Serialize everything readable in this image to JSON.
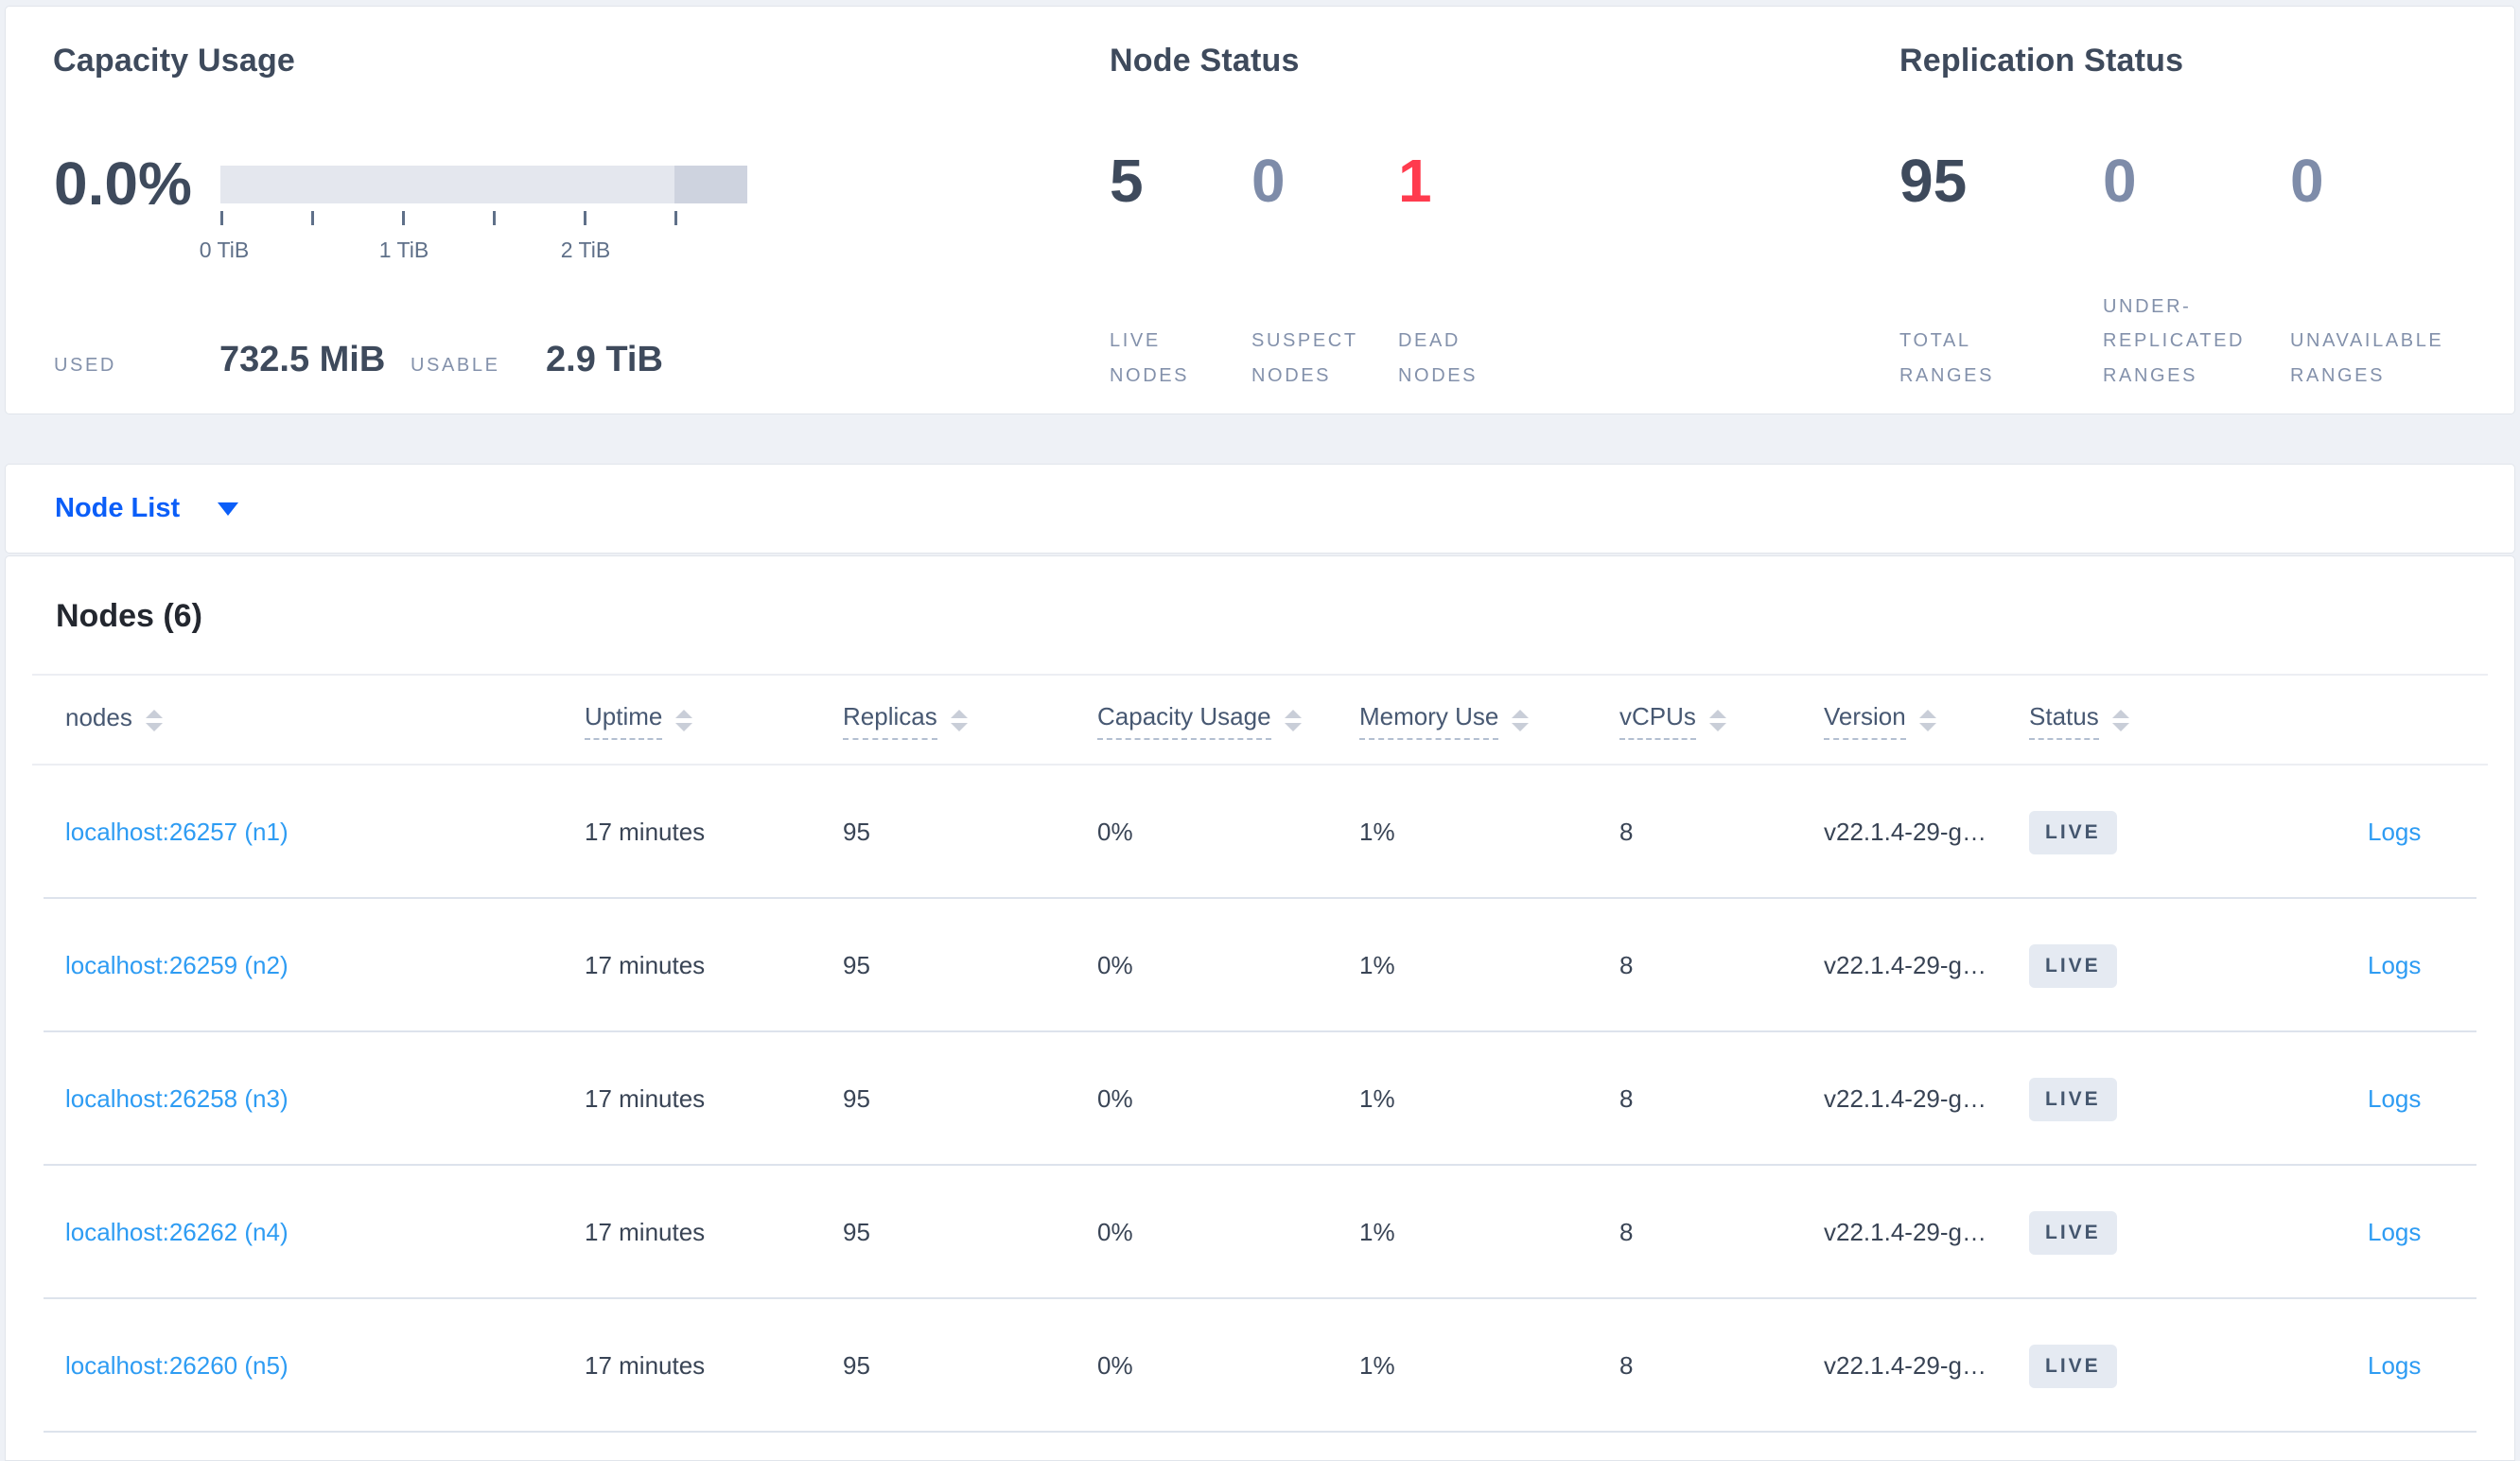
{
  "summary": {
    "capacity": {
      "title": "Capacity Usage",
      "percent": "0.0%",
      "tick_labels": [
        "0 TiB",
        "1 TiB",
        "2 TiB"
      ],
      "bar": {
        "used_fraction": 0.0,
        "dark_segment_start_fraction": 0.862,
        "max_tib": 2.9
      },
      "used_label": "USED",
      "used_value": "732.5 MiB",
      "usable_label": "USABLE",
      "usable_value": "2.9 TiB"
    },
    "node_status": {
      "title": "Node Status",
      "stats": [
        {
          "value": "5",
          "label": "LIVE NODES",
          "tone": "dark"
        },
        {
          "value": "0",
          "label": "SUSPECT NODES",
          "tone": "muted"
        },
        {
          "value": "1",
          "label": "DEAD NODES",
          "tone": "danger"
        }
      ]
    },
    "replication_status": {
      "title": "Replication Status",
      "stats": [
        {
          "value": "95",
          "label": "TOTAL RANGES",
          "tone": "dark"
        },
        {
          "value": "0",
          "label": "UNDER-REPLICATED RANGES",
          "tone": "muted"
        },
        {
          "value": "0",
          "label": "UNAVAILABLE RANGES",
          "tone": "muted"
        }
      ]
    }
  },
  "view_selector": {
    "label": "Node List"
  },
  "nodes_table": {
    "title": "Nodes (6)",
    "columns": [
      {
        "label": "nodes",
        "dashed": false
      },
      {
        "label": "Uptime",
        "dashed": true
      },
      {
        "label": "Replicas",
        "dashed": true
      },
      {
        "label": "Capacity Usage",
        "dashed": true
      },
      {
        "label": "Memory Use",
        "dashed": true
      },
      {
        "label": "vCPUs",
        "dashed": true
      },
      {
        "label": "Version",
        "dashed": true
      },
      {
        "label": "Status",
        "dashed": true
      }
    ],
    "rows": [
      {
        "node": "localhost:26257 (n1)",
        "uptime": "17 minutes",
        "replicas": "95",
        "capacity": "0%",
        "memory": "1%",
        "vcpus": "8",
        "version": "v22.1.4-29-g…",
        "status": "LIVE",
        "logs": "Logs"
      },
      {
        "node": "localhost:26259 (n2)",
        "uptime": "17 minutes",
        "replicas": "95",
        "capacity": "0%",
        "memory": "1%",
        "vcpus": "8",
        "version": "v22.1.4-29-g…",
        "status": "LIVE",
        "logs": "Logs"
      },
      {
        "node": "localhost:26258 (n3)",
        "uptime": "17 minutes",
        "replicas": "95",
        "capacity": "0%",
        "memory": "1%",
        "vcpus": "8",
        "version": "v22.1.4-29-g…",
        "status": "LIVE",
        "logs": "Logs"
      },
      {
        "node": "localhost:26262 (n4)",
        "uptime": "17 minutes",
        "replicas": "95",
        "capacity": "0%",
        "memory": "1%",
        "vcpus": "8",
        "version": "v22.1.4-29-g…",
        "status": "LIVE",
        "logs": "Logs"
      },
      {
        "node": "localhost:26260 (n5)",
        "uptime": "17 minutes",
        "replicas": "95",
        "capacity": "0%",
        "memory": "1%",
        "vcpus": "8",
        "version": "v22.1.4-29-g…",
        "status": "LIVE",
        "logs": "Logs"
      }
    ]
  },
  "colors": {
    "accent_blue": "#0b5ef8",
    "link_blue": "#2e9cf3",
    "danger_red": "#ff3b4e",
    "dark_slate": "#3e4a5c",
    "muted_slate": "#7e8ca9",
    "badge_bg": "#e5eaf2",
    "bar_light": "#e4e7ee",
    "bar_dark": "#ced3df"
  }
}
